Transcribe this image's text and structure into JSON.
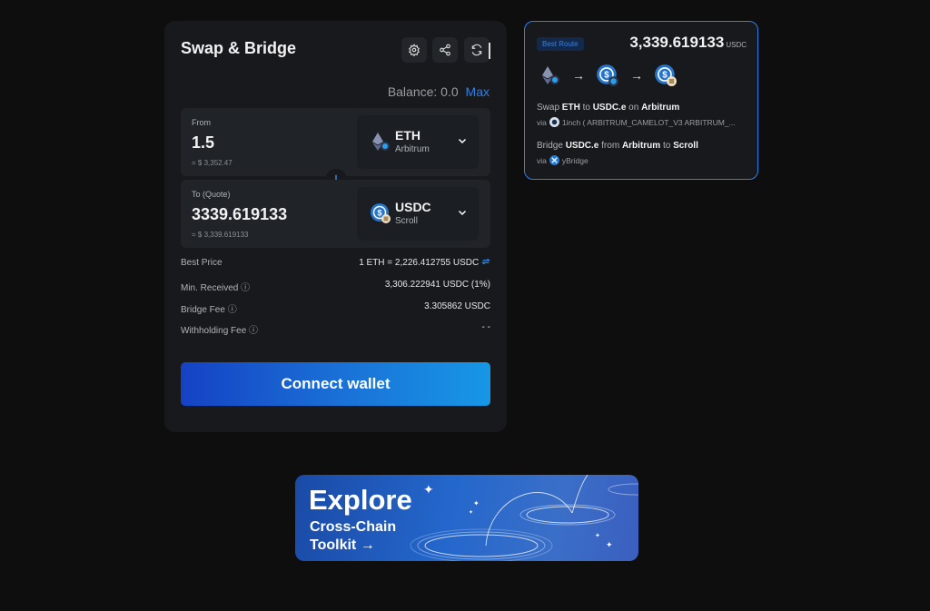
{
  "swap": {
    "title": "Swap & Bridge",
    "balance_label": "Balance: 0.0",
    "max_label": "Max",
    "from": {
      "label": "From",
      "amount": "1.5",
      "usd": "= $ 3,352.47",
      "token": "ETH",
      "chain": "Arbitrum"
    },
    "to": {
      "label": "To (Quote)",
      "amount": "3339.619133",
      "usd": "= $ 3,339.619133",
      "token": "USDC",
      "chain": "Scroll"
    },
    "info": [
      {
        "label": "Best Price",
        "value": "1 ETH = 2,226.412755 USDC"
      },
      {
        "label": "Min. Received",
        "value": "3,306.222941 USDC (1%)"
      },
      {
        "label": "Bridge Fee",
        "value": "3.305862 USDC"
      },
      {
        "label": "Withholding Fee",
        "value": "- -"
      }
    ],
    "connect_label": "Connect wallet"
  },
  "route": {
    "badge": "Best Route",
    "amount": "3,339.619133",
    "unit": "USDC",
    "step1": {
      "pre": "Swap ",
      "a": "ETH",
      "mid": " to ",
      "b": "USDC.e",
      "mid2": " on ",
      "c": "Arbitrum"
    },
    "step1_via": {
      "prefix": "via",
      "text": "1inch ( ARBITRUM_CAMELOT_V3 ARBITRUM_..."
    },
    "step2": {
      "pre": "Bridge ",
      "a": "USDC.e",
      "mid": " from ",
      "b": "Arbitrum",
      "mid2": " to ",
      "c": "Scroll"
    },
    "step2_via": {
      "prefix": "via",
      "text": "yBridge"
    }
  },
  "banner": {
    "line1": "Explore",
    "line2": "Cross-Chain",
    "line3": "Toolkit →"
  }
}
